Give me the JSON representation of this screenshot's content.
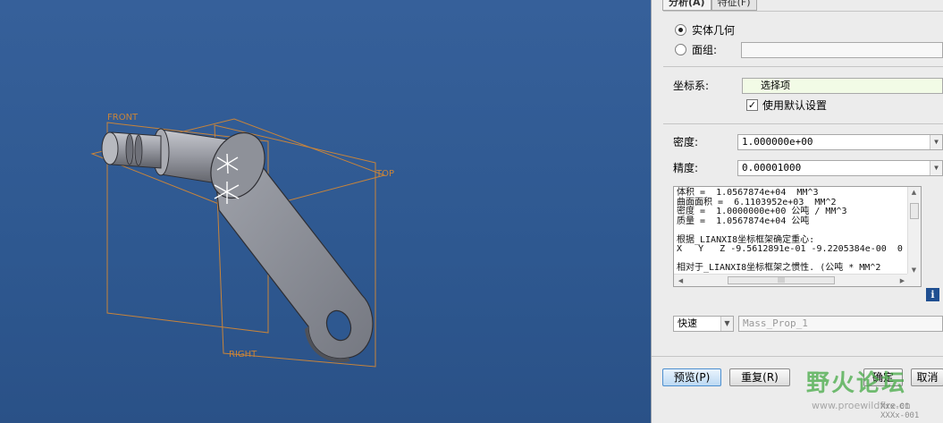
{
  "viewport": {
    "planes": {
      "front": "FRONT",
      "top": "TOP",
      "right": "RIGHT"
    },
    "colors": {
      "background": "#2e5890",
      "plane": "#c8843a",
      "model": "#8d9099"
    }
  },
  "panel": {
    "tabs": [
      {
        "label": "分析(A)",
        "active": true
      },
      {
        "label": "特征(F)",
        "active": false
      }
    ],
    "geometry_options": {
      "solid": "实体几何",
      "quilt": "面组:"
    },
    "selected_geometry": "solid",
    "coord_system": {
      "label": "坐标系:",
      "value": "选择项",
      "use_default_label": "使用默认设置",
      "use_default_checked": true
    },
    "density": {
      "label": "密度:",
      "value": "1.000000e+00"
    },
    "accuracy": {
      "label": "精度:",
      "value": "0.00001000"
    },
    "results_lines": [
      "体积 =  1.0567874e+04  MM^3",
      "曲面面积 =  6.1103952e+03  MM^2",
      "密度 =  1.0000000e+00 公吨 / MM^3",
      "质量 =  1.0567874e+04 公吨",
      "",
      "根据_LIANXI8坐标框架确定重心:",
      "X   Y   Z -9.5612891e-01 -9.2205384e-00  0",
      "",
      "相对于_LIANXI8坐标框架之惯性. (公吨 * MM^2"
    ],
    "mode": {
      "value": "快速"
    },
    "analysis_name": "Mass_Prop_1",
    "buttons": {
      "preview": "预览(P)",
      "repeat": "重复(R)",
      "ok": "确定",
      "cancel": "取消"
    },
    "watermark": {
      "text": "野火论坛",
      "url": "www.proewildfire.cn"
    },
    "version": {
      "line1": "Xxx-01",
      "line2": "XXXx-001"
    }
  }
}
